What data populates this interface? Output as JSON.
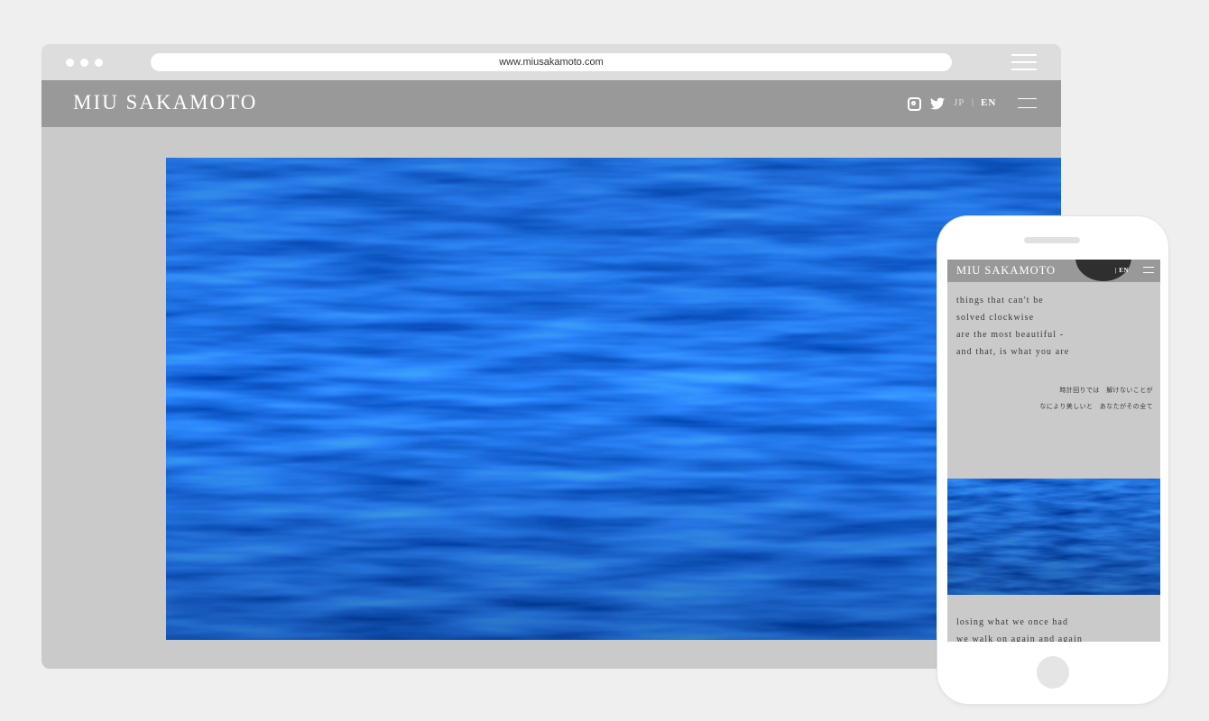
{
  "browser": {
    "url": "www.miusakamoto.com"
  },
  "site": {
    "logo": "MIU SAKAMOTO",
    "social": [
      "instagram-icon",
      "twitter-icon"
    ],
    "lang_jp": "JP",
    "lang_separator": "|",
    "lang_en": "EN",
    "hero_image": "ocean-water-photo"
  },
  "mobile": {
    "logo": "MIU SAKAMOTO",
    "lang": "| EN",
    "poem_en": [
      "things that can't be",
      "solved clockwise",
      "are the most beautiful -",
      "and that, is what you are"
    ],
    "poem_jp": [
      "時計回りでは　解けないことが",
      "なにより美しいと　あなたがその全て"
    ],
    "poem_en_2": [
      "losing what we once had",
      "we walk on again and again"
    ]
  },
  "colors": {
    "page_bg": "#efefef",
    "header_bg": "#999999",
    "content_bg": "#cacaca",
    "water_blue": "#3a64b4"
  }
}
